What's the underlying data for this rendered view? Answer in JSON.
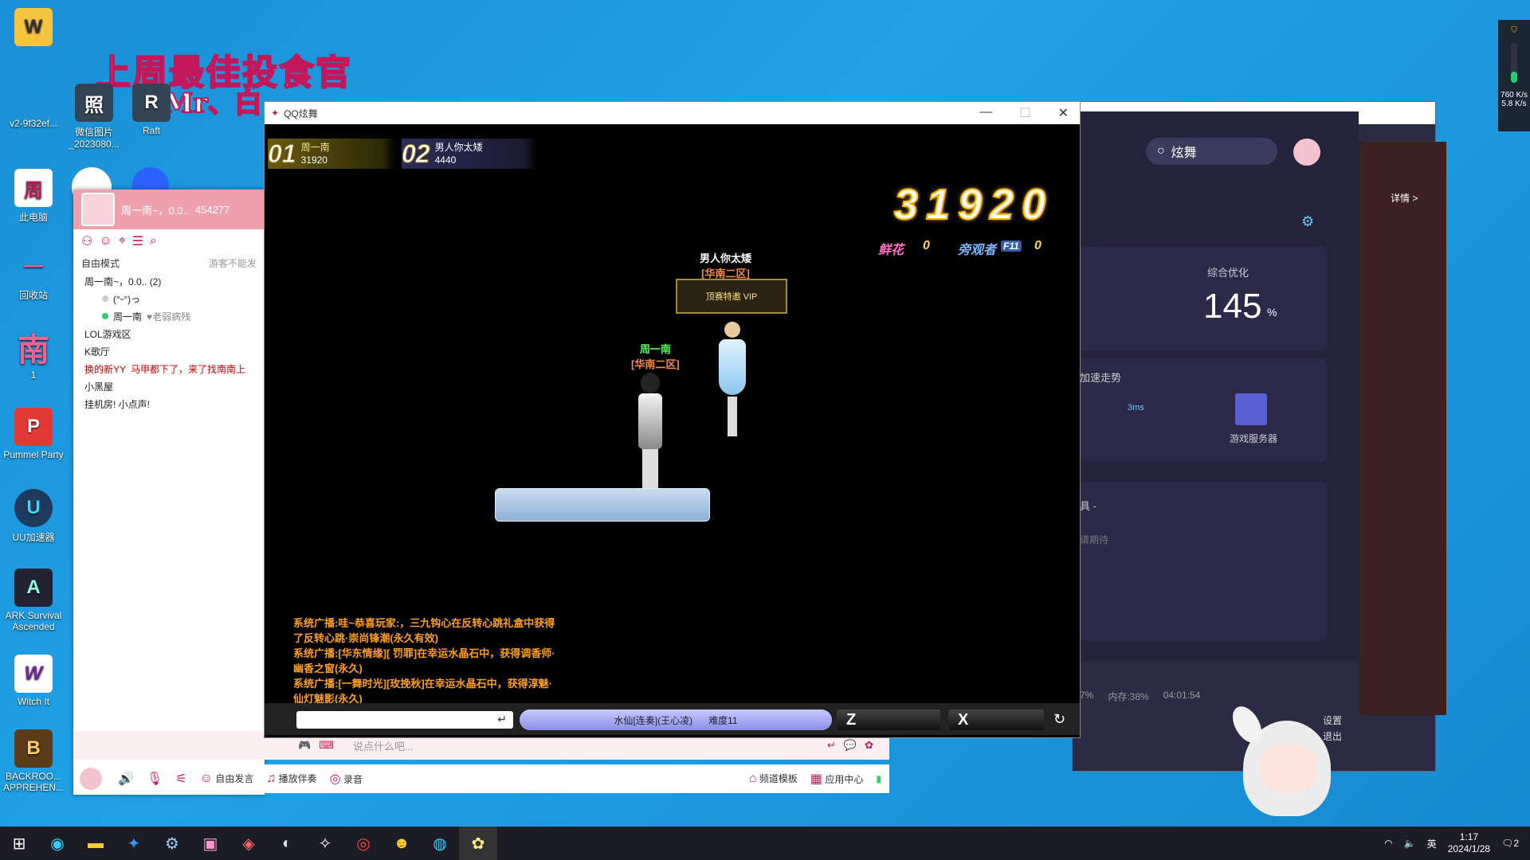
{
  "desktop": {
    "icons": [
      {
        "label": "v2-9f32ef...",
        "glyph": "W"
      },
      {
        "label": "此电脑",
        "glyph": "周"
      },
      {
        "label": "回收站",
        "glyph": "—"
      },
      {
        "label": "1",
        "glyph": "南"
      },
      {
        "label": "Pummel Party",
        "glyph": "P"
      },
      {
        "label": "UU加速器",
        "glyph": "U"
      },
      {
        "label": "ARK Survival Ascended",
        "glyph": "A"
      },
      {
        "label": "Witch It",
        "glyph": "W"
      },
      {
        "label": "BACKROO... APPREHEN...",
        "glyph": "B"
      }
    ],
    "icons2": [
      {
        "label": "微信图片_2023080...",
        "glyph": "照"
      },
      {
        "label": "Raft",
        "glyph": "R"
      }
    ],
    "overlay_title": "上周最佳投食官",
    "overlay_sub": "Mr、白"
  },
  "qq": {
    "user": "周一南~，0.0..",
    "uid": "454277",
    "mode": "自由模式",
    "guest_notice": "游客不能发",
    "tree": [
      {
        "label": "周一南~，0.0.. (2)",
        "level": 0
      },
      {
        "label": "(°ᵕ°)っ",
        "level": 1
      },
      {
        "label": "周一南",
        "note": "♥老弱病残",
        "level": 1
      },
      {
        "label": "LOL游戏区",
        "level": 0
      },
      {
        "label": "K歌厅",
        "level": 0
      },
      {
        "label": "换的新YY",
        "note": "马甲都下了，来了找南南上",
        "level": 0
      },
      {
        "label": "小黑屋",
        "level": 0
      },
      {
        "label": "挂机房! 小点声!",
        "level": 0
      }
    ],
    "input_placeholder": "说点什么吧...",
    "controls": {
      "free_speak": "自由发言",
      "play_accompany": "播放伴奏",
      "record": "录音",
      "channel_template": "频道模板",
      "app_center": "应用中心"
    }
  },
  "game": {
    "title": "QQ炫舞",
    "ranks": [
      {
        "num": "01",
        "name": "周一南",
        "score": "31920"
      },
      {
        "num": "02",
        "name": "男人你太矮",
        "score": "4440"
      }
    ],
    "big_score": "31920",
    "flower_label": "鲜花",
    "flower_value": "0",
    "viewer_label": "旁观者",
    "viewer_key": "F11",
    "viewer_value": "0",
    "players": [
      {
        "name": "男人你太矮",
        "server": "[华南二区]",
        "badge": "顶赛特邀 VIP"
      },
      {
        "name": "周一南",
        "server": "[华南二区]"
      }
    ],
    "broadcast": [
      "系统广播:哇~恭喜玩家:，三九钩心在反转心跳礼盒中获得了反转心跳·崇尚锋潮(永久有效)",
      "系统广播:[华东情缘][  罚罪]在幸运水晶石中，获得调香师·幽香之窗(永久)",
      "系统广播:[一舞时光][玫挽秋]在幸运水晶石中，获得淳魅·仙灯魅影(永久)"
    ],
    "song": "水仙[连奏](王心凌)",
    "difficulty": "难度11",
    "key_z": "Z",
    "key_x": "X"
  },
  "uu": {
    "search": "炫舞",
    "detail": "详情 >",
    "optimize_label": "综合优化",
    "optimize_value": "145",
    "optimize_unit": "%",
    "trend_label": "加速走势",
    "latency": "3ms",
    "server_label": "游戏服务器",
    "tools_label": "具 -",
    "stay_tuned": "请期待",
    "status": {
      "cpu": "7%",
      "mem": "内存:38%",
      "time": "04:01:54"
    },
    "menu": [
      "设置",
      "退出"
    ]
  },
  "tray": {
    "net_up": "760 K/s",
    "net_down": "5.8 K/s",
    "lang": "英",
    "time": "1:17",
    "date": "2024/1/28",
    "notify": "2"
  }
}
